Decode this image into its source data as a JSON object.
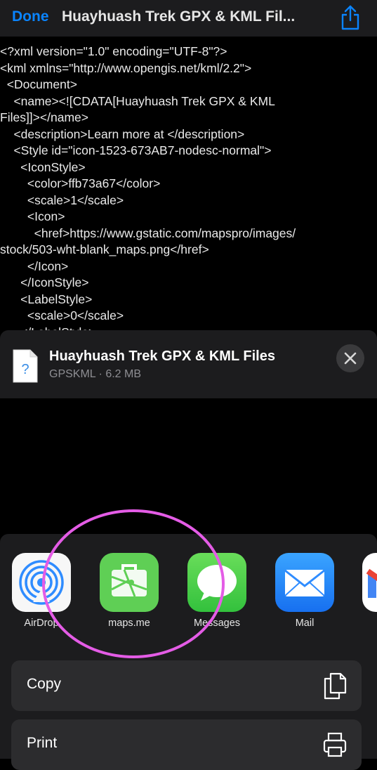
{
  "navbar": {
    "done_label": "Done",
    "title": "Huayhuash Trek GPX & KML Fil..."
  },
  "xml_lines": [
    "<?xml version=\"1.0\" encoding=\"UTF-8\"?>",
    "<kml xmlns=\"http://www.opengis.net/kml/2.2\">",
    "  <Document>",
    "    <name><![CDATA[Huayhuash Trek GPX & KML",
    "Files]]></name>",
    "    <description>Learn more at </description>",
    "    <Style id=\"icon-1523-673AB7-nodesc-normal\">",
    "      <IconStyle>",
    "        <color>ffb73a67</color>",
    "        <scale>1</scale>",
    "        <Icon>",
    "          <href>https://www.gstatic.com/mapspro/images/",
    "stock/503-wht-blank_maps.png</href>",
    "        </Icon>",
    "      </IconStyle>",
    "      <LabelStyle>",
    "        <scale>0</scale>",
    "      </LabelStyle>"
  ],
  "file": {
    "name": "Huayhuash Trek GPX & KML Files",
    "meta": "GPSKML · 6.2 MB",
    "icon_glyph": "?"
  },
  "apps": [
    {
      "label": "AirDrop",
      "icon": "airdrop-icon"
    },
    {
      "label": "maps.me",
      "icon": "mapsme-icon"
    },
    {
      "label": "Messages",
      "icon": "messages-icon"
    },
    {
      "label": "Mail",
      "icon": "mail-icon"
    },
    {
      "label": "",
      "icon": "gmail-icon"
    }
  ],
  "actions": [
    {
      "label": "Copy",
      "icon": "copy-icon"
    },
    {
      "label": "Print",
      "icon": "print-icon"
    }
  ],
  "colors": {
    "accent": "#0a84ff",
    "highlight_ring": "#e45ce6",
    "sheet_bg": "#1c1c1e",
    "action_bg": "#2c2c2e"
  }
}
